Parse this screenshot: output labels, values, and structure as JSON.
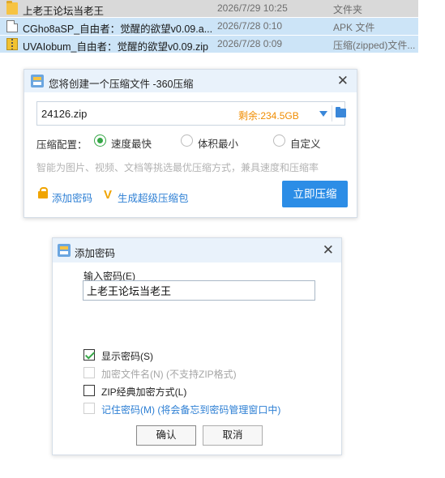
{
  "files": [
    {
      "name": "上老王论坛当老王",
      "date": "2026/7/29 10:25",
      "type": "文件夹",
      "icon": "folder-icon"
    },
    {
      "name": "CGho8aSP_自由者：觉醒的欲望v0.09.a...",
      "date": "2026/7/28 0:10",
      "type": "APK 文件",
      "icon": "file-icon"
    },
    {
      "name": "UVAIobum_自由者：觉醒的欲望v0.09.zip",
      "date": "2026/7/28 0:09",
      "type": "压缩(zipped)文件...",
      "icon": "zip-icon"
    }
  ],
  "compress_dialog": {
    "title": "您将创建一个压缩文件 -360压缩",
    "filename": "24126.zip",
    "remaining": "剩余:234.5GB",
    "config_label": "压缩配置：",
    "options": [
      {
        "label": "速度最快",
        "selected": true
      },
      {
        "label": "体积最小",
        "selected": false
      },
      {
        "label": "自定义",
        "selected": false
      }
    ],
    "hint": "智能为图片、视频、文档等挑选最优压缩方式，兼具速度和压缩率",
    "add_password_link": "添加密码",
    "super_package_link": "生成超级压缩包",
    "compress_button": "立即压缩",
    "accent_color": "#2c8de6"
  },
  "password_dialog": {
    "title": "添加密码",
    "input_label": "输入密码(E)",
    "password_value": "上老王论坛当老王",
    "checkboxes": [
      {
        "label": "显示密码(S)",
        "checked": true,
        "disabled": false
      },
      {
        "label": "加密文件名(N) (不支持ZIP格式)",
        "checked": false,
        "disabled": true
      },
      {
        "label": "ZIP经典加密方式(L)",
        "checked": false,
        "disabled": false
      },
      {
        "label": "记住密码(M) (将会备忘到密码管理窗口中)",
        "checked": false,
        "disabled": false
      }
    ],
    "ok_button": "确认",
    "cancel_button": "取消"
  }
}
